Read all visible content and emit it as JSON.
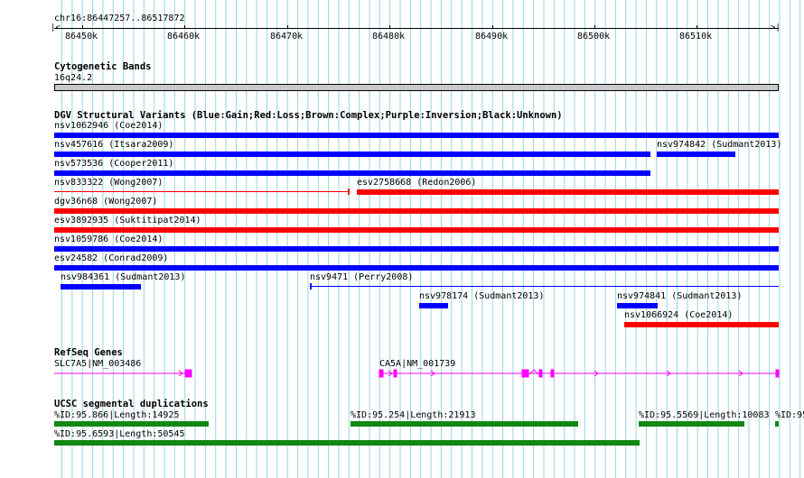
{
  "ruler": {
    "title": "chr16:86447257..86517872",
    "ticks": [
      "86450k",
      "86460k",
      "86470k",
      "86480k",
      "86490k",
      "86500k",
      "86510k"
    ]
  },
  "colors": {
    "grid": "#9ad3e6",
    "gain": "#0000ff",
    "loss": "#ff0000",
    "gene": "#ff00ff",
    "segdup": "#118811"
  },
  "tracks": {
    "cyto": {
      "title": "Cytogenetic Bands",
      "band": "16q24.2"
    },
    "dgv": {
      "title": "DGV Structural Variants (Blue:Gain;Red:Loss;Brown:Complex;Purple:Inversion;Black:Unknown)",
      "items": [
        {
          "label": "nsv1062946 (Coe2014)",
          "type": "gain"
        },
        {
          "label": "nsv457616 (Itsara2009)",
          "type": "gain"
        },
        {
          "label": "nsv974842 (Sudmant2013)",
          "type": "gain"
        },
        {
          "label": "nsv573536 (Cooper2011)",
          "type": "gain"
        },
        {
          "label": "nsv833322 (Wong2007)",
          "type": "loss"
        },
        {
          "label": "esv2758668 (Redon2006)",
          "type": "loss"
        },
        {
          "label": "dgv36n68 (Wong2007)",
          "type": "loss"
        },
        {
          "label": "esv3892935 (Suktitipat2014)",
          "type": "loss"
        },
        {
          "label": "nsv1059786 (Coe2014)",
          "type": "gain"
        },
        {
          "label": "esv24582 (Conrad2009)",
          "type": "gain"
        },
        {
          "label": "nsv984361 (Sudmant2013)",
          "type": "gain"
        },
        {
          "label": "nsv9471 (Perry2008)",
          "type": "gain"
        },
        {
          "label": "nsv978174 (Sudmant2013)",
          "type": "gain"
        },
        {
          "label": "nsv974841 (Sudmant2013)",
          "type": "gain"
        },
        {
          "label": "nsv1066924 (Coe2014)",
          "type": "loss"
        }
      ]
    },
    "refseq": {
      "title": "RefSeq Genes",
      "genes": [
        "SLC7A5|NM_003486",
        "CA5A|NM_001739"
      ]
    },
    "segdup": {
      "title": "UCSC segmental duplications",
      "items": [
        "%ID:95.866|Length:14925",
        "%ID:95.254|Length:21913",
        "%ID:95.5569|Length:10083",
        "%ID:95",
        "%ID:95.6593|Length:50545"
      ]
    }
  }
}
